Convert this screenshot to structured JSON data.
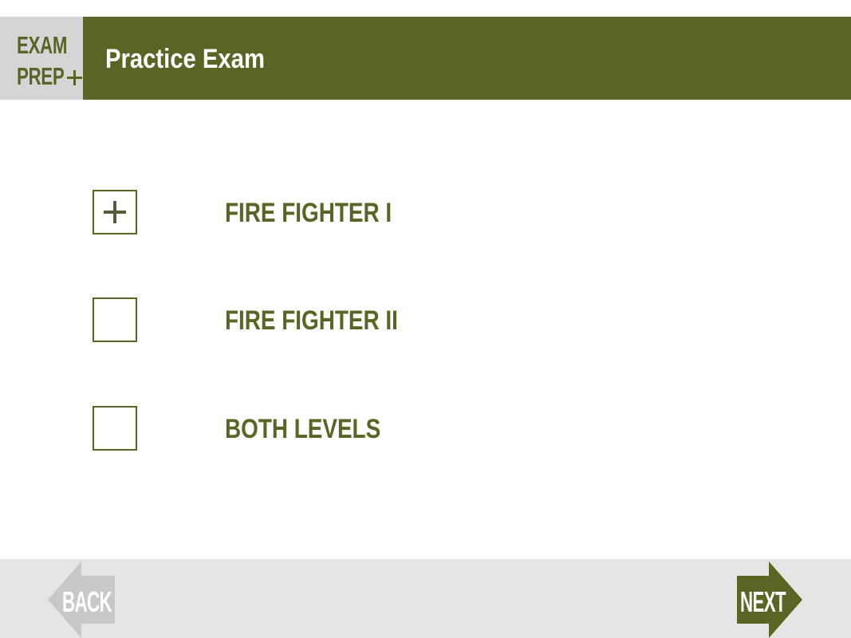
{
  "header": {
    "logo_line1": "EXAM",
    "logo_line2": "PREP",
    "title": "Practice Exam"
  },
  "options": [
    {
      "label": "FIRE FIGHTER I",
      "selected": true
    },
    {
      "label": "FIRE FIGHTER II",
      "selected": false
    },
    {
      "label": "BOTH LEVELS",
      "selected": false
    }
  ],
  "footer": {
    "back_label": "BACK",
    "next_label": "NEXT"
  },
  "colors": {
    "brand_green": "#5b6424",
    "logo_bg": "#d5d5d5",
    "footer_bg": "#e5e5e5",
    "back_arrow": "#c8c8c8"
  },
  "icons": {
    "logo_plus": "plus-icon",
    "selected_mark": "plus-icon",
    "back": "arrow-left-icon",
    "next": "arrow-right-icon"
  }
}
